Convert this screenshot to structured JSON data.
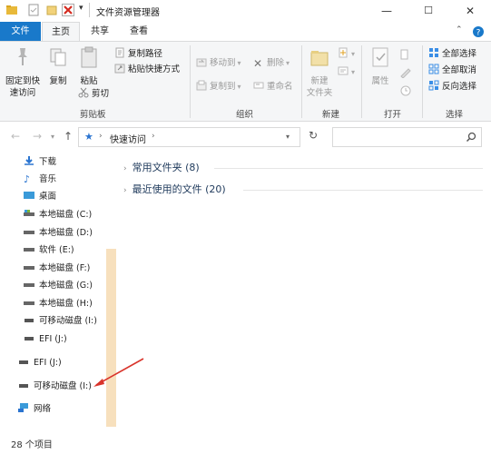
{
  "window": {
    "title": "文件资源管理器",
    "controls": [
      "—",
      "☐",
      "✕"
    ]
  },
  "tabs": {
    "file": "文件",
    "home": "主页",
    "share": "共享",
    "view": "查看"
  },
  "ribbon": {
    "clipboard": {
      "pin_label_1": "固定到快",
      "pin_label_2": "速访问",
      "copy_label": "复制",
      "paste_label": "粘贴",
      "copy_path_label": "复制路径",
      "paste_shortcut_label": "粘贴快捷方式",
      "cut_label": "剪切",
      "group_label": "剪贴板"
    },
    "organize": {
      "move_to_label": "移动到",
      "copy_to_label": "复制到",
      "delete_label": "删除",
      "rename_label": "重命名",
      "group_label": "组织"
    },
    "new": {
      "new_folder_label_1": "新建",
      "new_folder_label_2": "文件夹",
      "group_label": "新建"
    },
    "open": {
      "properties_label": "属性",
      "group_label": "打开"
    },
    "select": {
      "select_all_label": "全部选择",
      "select_none_label": "全部取消",
      "invert_label": "反向选择",
      "group_label": "选择"
    }
  },
  "address": {
    "path": "快速访问",
    "search_placeholder": ""
  },
  "nav": {
    "items": [
      {
        "label": "下载",
        "icon": "download-icon"
      },
      {
        "label": "音乐",
        "icon": "music-icon"
      },
      {
        "label": "桌面",
        "icon": "desktop-icon"
      },
      {
        "label": "本地磁盘 (C:)",
        "icon": "drive-icon"
      },
      {
        "label": "本地磁盘 (D:)",
        "icon": "drive-icon"
      },
      {
        "label": "软件 (E:)",
        "icon": "drive-icon"
      },
      {
        "label": "本地磁盘 (F:)",
        "icon": "drive-icon"
      },
      {
        "label": "本地磁盘 (G:)",
        "icon": "drive-icon"
      },
      {
        "label": "本地磁盘 (H:)",
        "icon": "drive-icon"
      },
      {
        "label": "可移动磁盘 (I:)",
        "icon": "usb-drive-icon"
      },
      {
        "label": "EFI (J:)",
        "icon": "drive-icon"
      },
      {
        "label": "EFI (J:)",
        "icon": "drive-icon"
      },
      {
        "label": "可移动磁盘 (I:)",
        "icon": "usb-drive-icon"
      },
      {
        "label": "网络",
        "icon": "network-icon"
      }
    ]
  },
  "content": {
    "groups": [
      {
        "label": "常用文件夹 (8)"
      },
      {
        "label": "最近使用的文件 (20)"
      }
    ]
  },
  "status": {
    "count": "28 个项目"
  },
  "colors": {
    "accent": "#1979ca",
    "annotation_arrow": "#d9342b"
  }
}
